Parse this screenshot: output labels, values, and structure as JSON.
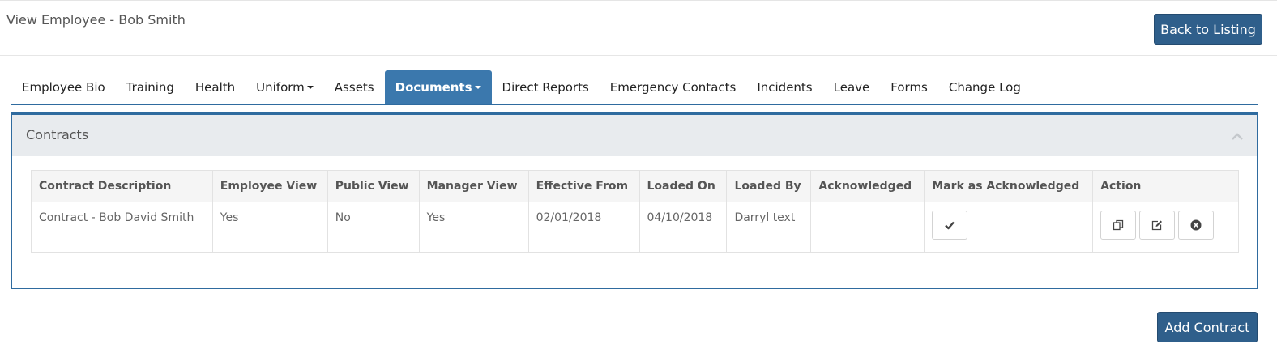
{
  "header": {
    "title": "View Employee - Bob Smith",
    "back_label": "Back to Listing"
  },
  "tabs": [
    {
      "label": "Employee Bio",
      "active": false,
      "dropdown": false
    },
    {
      "label": "Training",
      "active": false,
      "dropdown": false
    },
    {
      "label": "Health",
      "active": false,
      "dropdown": false
    },
    {
      "label": "Uniform",
      "active": false,
      "dropdown": true
    },
    {
      "label": "Assets",
      "active": false,
      "dropdown": false
    },
    {
      "label": "Documents",
      "active": true,
      "dropdown": true
    },
    {
      "label": "Direct Reports",
      "active": false,
      "dropdown": false
    },
    {
      "label": "Emergency Contacts",
      "active": false,
      "dropdown": false
    },
    {
      "label": "Incidents",
      "active": false,
      "dropdown": false
    },
    {
      "label": "Leave",
      "active": false,
      "dropdown": false
    },
    {
      "label": "Forms",
      "active": false,
      "dropdown": false
    },
    {
      "label": "Change Log",
      "active": false,
      "dropdown": false
    }
  ],
  "panel": {
    "title": "Contracts",
    "collapse_icon": "chevron-up-icon"
  },
  "table": {
    "columns": [
      "Contract Description",
      "Employee View",
      "Public View",
      "Manager View",
      "Effective From",
      "Loaded On",
      "Loaded By",
      "Acknowledged",
      "Mark as Acknowledged",
      "Action"
    ],
    "rows": [
      {
        "description": "Contract - Bob David Smith",
        "employee_view": "Yes",
        "public_view": "No",
        "manager_view": "Yes",
        "effective_from": "02/01/2018",
        "loaded_on": "04/10/2018",
        "loaded_by": "Darryl text",
        "acknowledged": ""
      }
    ],
    "row_icons": {
      "acknowledge": "check-icon",
      "copy": "copy-icon",
      "edit": "edit-icon",
      "delete": "close-circle-icon"
    }
  },
  "footer": {
    "add_label": "Add Contract"
  },
  "colors": {
    "primary": "#2f5f8b",
    "active_tab": "#3b78ad",
    "panel_border": "#2f6b9f",
    "panel_head": "#e8ebee"
  }
}
